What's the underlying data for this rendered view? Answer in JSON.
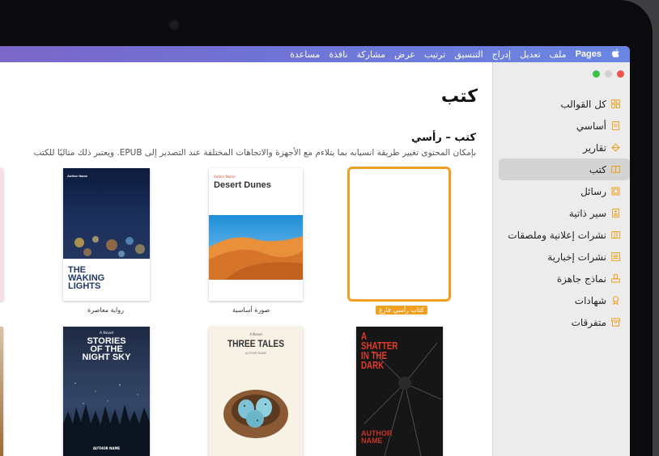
{
  "menubar": {
    "items": [
      "Pages",
      "ملف",
      "تعديل",
      "إدراج",
      "التنسيق",
      "ترتيب",
      "عرض",
      "مشاركة",
      "نافذة",
      "مساعدة"
    ]
  },
  "sidebar": {
    "items": [
      {
        "label": "كل القوالب",
        "icon": "grid-icon"
      },
      {
        "label": "أساسي",
        "icon": "document-icon"
      },
      {
        "label": "تقارير",
        "icon": "report-icon"
      },
      {
        "label": "كتب",
        "icon": "book-icon",
        "active": true
      },
      {
        "label": "رسائل",
        "icon": "letter-icon"
      },
      {
        "label": "سير ذاتية",
        "icon": "resume-icon"
      },
      {
        "label": "نشرات إعلانية وملصقات",
        "icon": "flyer-icon"
      },
      {
        "label": "نشرات إخبارية",
        "icon": "newsletter-icon"
      },
      {
        "label": "نماذج جاهزة",
        "icon": "stationery-icon"
      },
      {
        "label": "شهادات",
        "icon": "certificate-icon"
      },
      {
        "label": "متفرقات",
        "icon": "misc-icon"
      }
    ]
  },
  "main": {
    "heading": "كتب",
    "subheading": "كتب – رأسي",
    "description": "بإمكان المحتوى تغيير طريقة انسيابه بما يتلاءم مع الأجهزة والاتجاهات المختلفة عند التصدير إلى EPUB. ويعتبر ذلك مثاليًا للكتب"
  },
  "templates": {
    "blank": {
      "caption": "كتاب رأسي فارغ"
    },
    "basic": {
      "caption": "صورة أساسية",
      "author": "Author Name",
      "title": "Desert Dunes"
    },
    "novel": {
      "caption": "رواية معاصرة",
      "author": "Author Name",
      "title_lines": [
        "THE",
        "WAKING",
        "LIGHTS"
      ]
    },
    "night": {
      "kicker": "A Novel",
      "title_lines": [
        "STORIES",
        "OF THE",
        "NIGHT SKY"
      ],
      "author": "AUTHOR NAME"
    },
    "tales": {
      "kicker": "A Novel",
      "title": "THREE TALES",
      "author": "AUTHOR NAME"
    },
    "dark": {
      "title_lines": [
        "A",
        "SHATTER",
        "IN THE",
        "DARK"
      ],
      "author_lines": [
        "AUTHOR",
        "NAME"
      ]
    }
  },
  "colors": {
    "accent": "#f0a020",
    "menubar": "#7070d8"
  }
}
